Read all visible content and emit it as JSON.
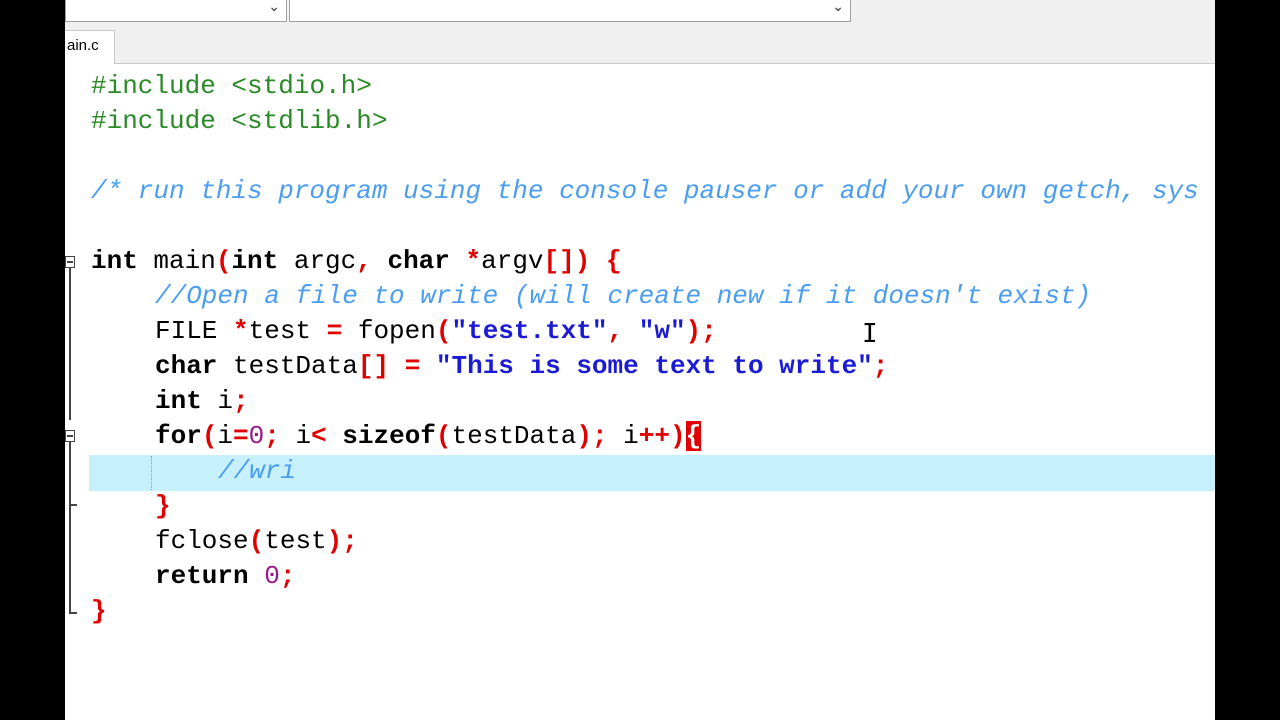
{
  "tab": {
    "label": "ain.c"
  },
  "code": {
    "include1": {
      "directive": "#include",
      "header": " <stdio.h>"
    },
    "include2": {
      "directive": "#include",
      "header": " <stdlib.h>"
    },
    "comment1": "/* run this program using the console pauser or add your own getch, sys",
    "main_sig": {
      "kw1": "int",
      "name": " main",
      "p1": "(",
      "kw2": "int",
      "argc": " argc",
      "comma": ",",
      "kw3": " char",
      "star": " *",
      "argv": "argv",
      "brk": "[])",
      "brace": " {"
    },
    "comment2": "//Open a file to write (will create new if it doesn't exist)",
    "fopen_line": {
      "type": "FILE ",
      "star": "*",
      "var": "test ",
      "eq": "=",
      "fn": " fopen",
      "lp": "(",
      "s1": "\"test.txt\"",
      "comma": ", ",
      "s2": "\"w\"",
      "rp": ");"
    },
    "char_line": {
      "kw": "char",
      "name": " testData",
      "brk": "[]",
      "eq": " =",
      "str": " \"This is some text to write\"",
      "semi": ";"
    },
    "int_line": {
      "kw": "int",
      "name": " i",
      "semi": ";"
    },
    "for_line": {
      "kw": "for",
      "lp": "(",
      "i1": "i",
      "eq": "=",
      "zero": "0",
      "semi1": ";",
      "i2": " i",
      "lt": "<",
      "kw2": " sizeof",
      "lp2": "(",
      "arg": "testData",
      "rp2": ")",
      "semi2": ";",
      "i3": " i",
      "inc": "++",
      "rp": ")",
      "brace": "{"
    },
    "current_line": "//wri",
    "close_inner": "}",
    "fclose_line": {
      "fn": "fclose",
      "lp": "(",
      "arg": "test",
      "rp": ");"
    },
    "return_line": {
      "kw": "return",
      "num": " 0",
      "semi": ";"
    },
    "close_main": "}"
  },
  "colors": {
    "keyword": "#000000",
    "preprocessor": "#2a8a26",
    "comment": "#4a9df1",
    "string": "#1b1bd6",
    "number": "#9b1a8a",
    "operator": "#e00000",
    "current_line_bg": "#c7f0fd"
  },
  "cursor": {
    "icon": "ibeam-cursor-icon"
  }
}
